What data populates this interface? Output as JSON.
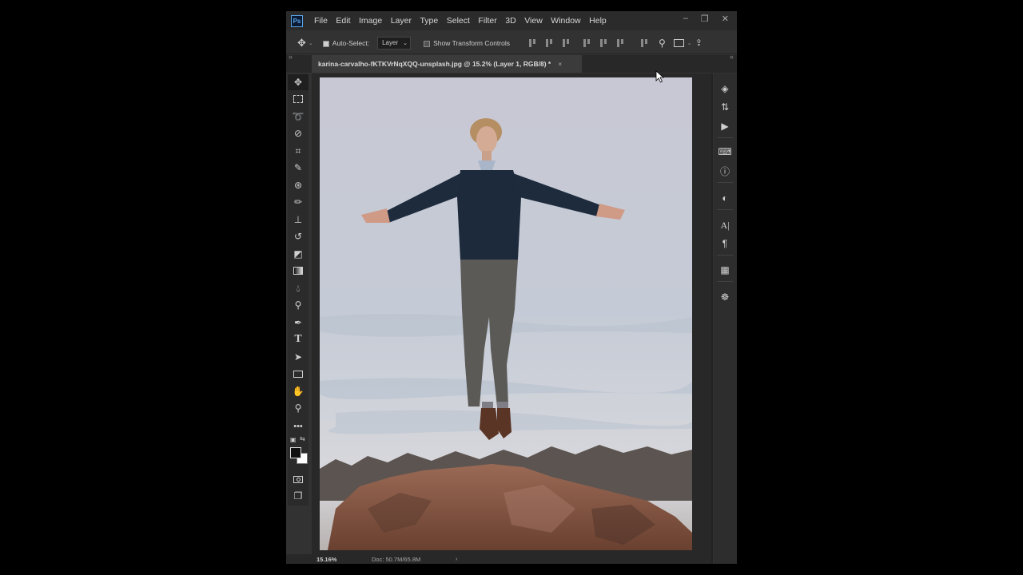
{
  "app": {
    "logo": "Ps",
    "menu": [
      "File",
      "Edit",
      "Image",
      "Layer",
      "Type",
      "Select",
      "Filter",
      "3D",
      "View",
      "Window",
      "Help"
    ],
    "window_controls": [
      "–",
      "❐",
      "✕"
    ]
  },
  "options_bar": {
    "auto_select_label": "Auto-Select:",
    "auto_select_checked": true,
    "auto_select_target": "Layer",
    "show_transform_controls_label": "Show Transform Controls",
    "show_transform_controls_checked": false
  },
  "document_tab": {
    "title": "karina-carvalho-fKTKVrNqXQQ-unsplash.jpg @ 15.2% (Layer 1, RGB/8) *",
    "close_glyph": "×"
  },
  "toolbar": {
    "tools": [
      "move",
      "rectangular-marquee",
      "lasso",
      "quick-selection",
      "crop",
      "eyedropper",
      "spot-healing-brush",
      "brush",
      "clone-stamp",
      "history-brush",
      "eraser",
      "gradient",
      "blur",
      "dodge",
      "pen",
      "type",
      "path-selection",
      "rectangle",
      "hand",
      "zoom",
      "more"
    ],
    "active_tool": "move",
    "foreground_color": "#111111",
    "background_color": "#ffffff"
  },
  "right_panel": {
    "icons": [
      "layers",
      "adjustments",
      "actions",
      "libraries",
      "info",
      "color",
      "character",
      "paragraph",
      "swatches",
      "properties"
    ]
  },
  "status_bar": {
    "zoom": "15.16%",
    "doc_size": "Doc: 50.7M/65.8M",
    "arrow": "›"
  },
  "colors": {
    "app_bg": "#323232",
    "menubar_bg": "#2b2b2b",
    "accent_logo": "#5aa5e6",
    "sky": "#c8ccd6",
    "rock": "#8a5a45",
    "sweater": "#1c2a3c",
    "trousers": "#5a5a58"
  }
}
